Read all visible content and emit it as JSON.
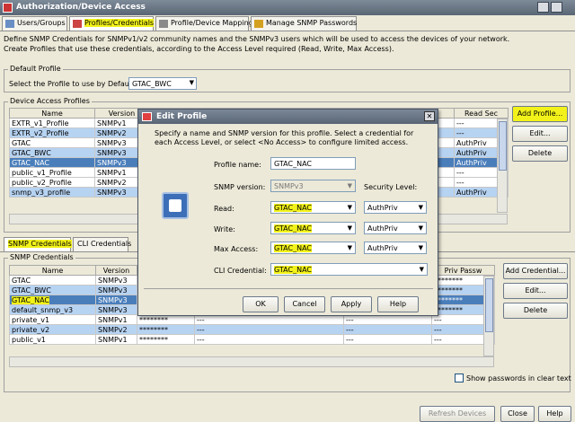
{
  "window": {
    "title": "Authorization/Device Access"
  },
  "tabs": [
    {
      "label": "Users/Groups"
    },
    {
      "label": "Profiles/Credentials"
    },
    {
      "label": "Profile/Device Mapping"
    },
    {
      "label": "Manage SNMP Passwords"
    }
  ],
  "description": {
    "line1": "Define SNMP Credentials for SNMPv1/v2 community names and the SNMPv3 users which will be used to access the devices of your network.",
    "line2": "Create Profiles that use these credentials, according to the Access Level required (Read, Write, Max Access)."
  },
  "default_profile": {
    "group_label": "Default Profile",
    "label": "Select the Profile to use by Default",
    "value": "GTAC_BWC"
  },
  "device_profiles": {
    "group_label": "Device Access Profiles",
    "columns": [
      "Name",
      "Version",
      "Read Sec"
    ],
    "rows": [
      {
        "name": "EXTR_v1_Profile",
        "version": "SNMPv1",
        "sec": "---"
      },
      {
        "name": "EXTR_v2_Profile",
        "version": "SNMPv2",
        "sec": "---"
      },
      {
        "name": "GTAC",
        "version": "SNMPv3",
        "sec": "AuthPriv"
      },
      {
        "name": "GTAC_BWC",
        "version": "SNMPv3",
        "sec": "AuthPriv"
      },
      {
        "name": "GTAC_NAC",
        "version": "SNMPv3",
        "sec": "AuthPriv"
      },
      {
        "name": "public_v1_Profile",
        "version": "SNMPv1",
        "sec": "---"
      },
      {
        "name": "public_v2_Profile",
        "version": "SNMPv2",
        "sec": "---"
      },
      {
        "name": "snmp_v3_profile",
        "version": "SNMPv3",
        "sec": "AuthPriv"
      }
    ],
    "buttons": {
      "add": "Add Profile...",
      "edit": "Edit...",
      "delete": "Delete"
    }
  },
  "sub_tabs": [
    {
      "label": "SNMP Credentials"
    },
    {
      "label": "CLI Credentials"
    }
  ],
  "snmp_credentials": {
    "group_label": "SNMP Credentials",
    "columns": [
      "Name",
      "Version",
      "Priv Passw"
    ],
    "rows": [
      {
        "name": "GTAC",
        "version": "SNMPv3",
        "c3": "",
        "c4": "",
        "c5": "",
        "priv": "********"
      },
      {
        "name": "GTAC_BWC",
        "version": "SNMPv3",
        "c3": "",
        "c4": "",
        "c5": "",
        "priv": "********"
      },
      {
        "name": "GTAC_NAC",
        "version": "SNMPv3",
        "c3": "",
        "c4": "",
        "c5": "",
        "priv": "********"
      },
      {
        "name": "default_snmp_v3",
        "version": "SNMPv3",
        "c3": "",
        "c4": "",
        "c5": "",
        "priv": "********"
      },
      {
        "name": "private_v1",
        "version": "SNMPv1",
        "c3": "********",
        "c4": "---",
        "c5": "---",
        "priv": "---"
      },
      {
        "name": "private_v2",
        "version": "SNMPv2",
        "c3": "********",
        "c4": "---",
        "c5": "---",
        "priv": "---"
      },
      {
        "name": "public_v1",
        "version": "SNMPv1",
        "c3": "********",
        "c4": "---",
        "c5": "---",
        "priv": "---"
      }
    ],
    "buttons": {
      "add": "Add Credential...",
      "edit": "Edit...",
      "delete": "Delete"
    },
    "show_passwords": "Show passwords in clear text"
  },
  "footer": {
    "refresh": "Refresh Devices",
    "close": "Close",
    "help": "Help"
  },
  "dialog": {
    "title": "Edit Profile",
    "instructions": "Specify a name and SNMP version for this profile.  Select a credential for each Access Level, or select <No Access> to configure limited access.",
    "profile_name_label": "Profile name:",
    "profile_name": "GTAC_NAC",
    "snmp_version_label": "SNMP version:",
    "snmp_version": "SNMPv3",
    "security_level_label": "Security Level:",
    "read_label": "Read:",
    "read_value": "GTAC_NAC",
    "read_sec": "AuthPriv",
    "write_label": "Write:",
    "write_value": "GTAC_NAC",
    "write_sec": "AuthPriv",
    "max_label": "Max Access:",
    "max_value": "GTAC_NAC",
    "max_sec": "AuthPriv",
    "cli_label": "CLI Credential:",
    "cli_value": "GTAC_NAC",
    "buttons": {
      "ok": "OK",
      "cancel": "Cancel",
      "apply": "Apply",
      "help": "Help"
    }
  },
  "colors": {
    "highlight": "#f2f21a",
    "selection": "#4a7ebb",
    "alt_row": "#b7d3f2"
  }
}
